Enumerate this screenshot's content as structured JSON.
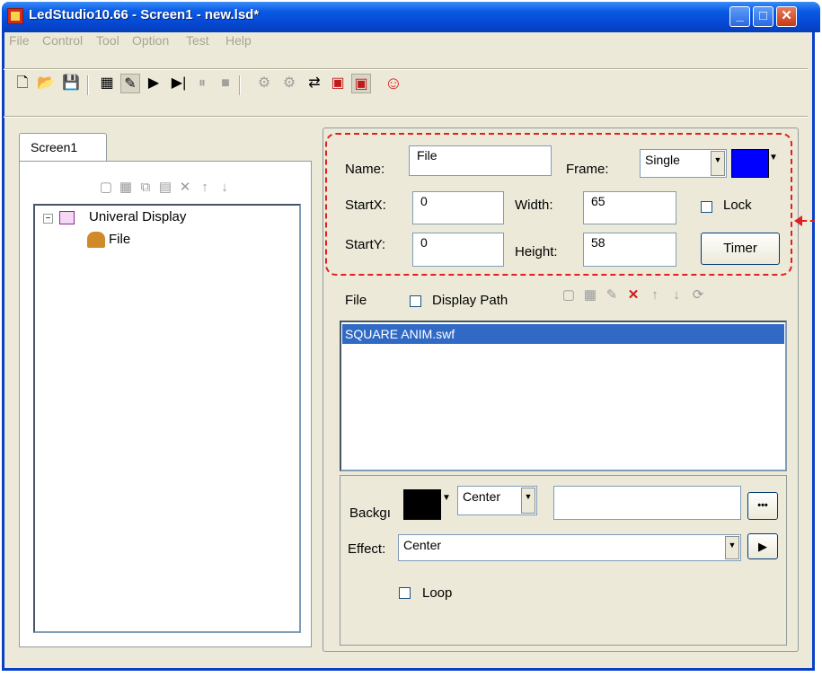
{
  "window": {
    "title": "LedStudio10.66 - Screen1 - new.lsd*",
    "min_icon": "minimize-icon",
    "max_icon": "maximize-icon",
    "close_icon": "close-icon",
    "min_glyph": "_",
    "max_glyph": "□",
    "close_glyph": "✕"
  },
  "menu": [
    "File",
    "Control",
    "Tool",
    "Option",
    "Test",
    "Help"
  ],
  "toolbar": {
    "icons": [
      "new-file-icon",
      "open-folder-icon",
      "save-icon",
      "screen-window-icon",
      "edit-window-icon",
      "play-icon",
      "step-play-icon",
      "pause-icon",
      "stop-icon",
      "connect-icon",
      "disconnect-icon",
      "network-icon",
      "send-icon",
      "receive-icon",
      "smiley-icon"
    ],
    "glyphs": [
      "🗋",
      "📂",
      "💾",
      "▦",
      "✎",
      "▶",
      "▶|",
      "⏸",
      "■",
      "⚙",
      "⚙",
      "⇄",
      "▣",
      "▣",
      "☺"
    ]
  },
  "screen_tab": {
    "label": "Screen1"
  },
  "left_tools": {
    "icons": [
      "new-item-icon",
      "add-item-icon",
      "copy-icon",
      "paste-icon",
      "delete-icon",
      "move-up-icon",
      "move-down-icon"
    ],
    "glyphs": [
      "▢",
      "▦",
      "⧉",
      "▤",
      "✕",
      "↑",
      "↓"
    ]
  },
  "tree": {
    "root_label": "Univeral Display",
    "expander": "−",
    "child_label": "File"
  },
  "properties": {
    "name_label": "Name:",
    "name_value": "File",
    "frame_label": "Frame:",
    "frame_value": "Single",
    "frame_color": "#0000ff",
    "startx_label": "StartX:",
    "startx_value": "0",
    "width_label": "Width:",
    "width_value": "65",
    "lock_label": "Lock",
    "starty_label": "StartY:",
    "starty_value": "0",
    "height_label": "Height:",
    "height_value": "58",
    "timer_label": "Timer"
  },
  "file_section": {
    "label": "File",
    "display_path_label": "Display Path",
    "tool_icons": [
      "new-item-icon",
      "add-item-icon",
      "edit-icon",
      "delete-icon",
      "move-up-icon",
      "move-down-icon",
      "refresh-icon"
    ],
    "tool_glyphs": [
      "▢",
      "▦",
      "✎",
      "✕",
      "↑",
      "↓",
      "⟳"
    ],
    "files": [
      "SQUARE ANIM.swf"
    ]
  },
  "options": {
    "background_label": "Backgı",
    "background_color": "#000000",
    "align_value": "Center",
    "browse_label": "•••",
    "effect_label": "Effect:",
    "effect_value": "Center",
    "play_glyph": "▶",
    "loop_label": "Loop"
  },
  "colors": {
    "accent": "#e02020",
    "selection": "#316ac5",
    "titlebar": "#0548d4"
  }
}
